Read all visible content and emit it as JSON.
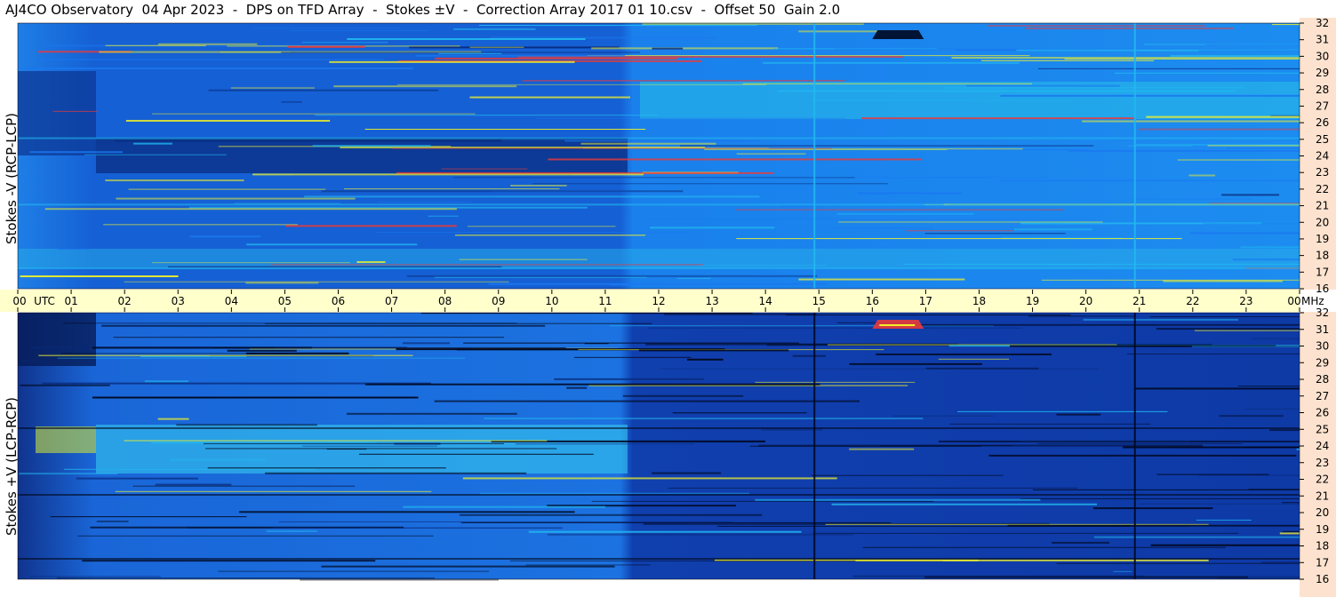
{
  "title": "AJ4CO Observatory  04 Apr 2023  -  DPS on TFD Array  -  Stokes ±V  -  Correction Array 2017 01 10.csv  -  Offset 50  Gain 2.0",
  "colors": {
    "time_axis_bg": "#ffffcc",
    "freq_axis_bg": "#fde3cf",
    "colormap": [
      "#000820",
      "#082a7a",
      "#1046c8",
      "#1a78f0",
      "#22b8f0",
      "#f0f02a",
      "#e83a3a",
      "#ff70ff"
    ]
  },
  "chart_data": [
    {
      "type": "heatmap",
      "panel": "top",
      "ylabel": "Stokes -V (RCP-LCP)",
      "x_ticks": [
        "00",
        "UTC",
        "01",
        "02",
        "03",
        "04",
        "05",
        "06",
        "07",
        "08",
        "09",
        "10",
        "11",
        "12",
        "13",
        "14",
        "15",
        "16",
        "17",
        "18",
        "19",
        "20",
        "21",
        "22",
        "23",
        "00",
        "MHz"
      ],
      "x_range_hours": [
        0,
        24
      ],
      "y_range_mhz": [
        16,
        32
      ],
      "y_ticks": [
        "32",
        "31",
        "30",
        "29",
        "28",
        "27",
        "26",
        "25",
        "24",
        "23",
        "22",
        "21",
        "20",
        "19",
        "18",
        "17",
        "16"
      ]
    },
    {
      "type": "heatmap",
      "panel": "bottom",
      "ylabel": "Stokes +V (LCP-RCP)",
      "x_ticks": [
        "00",
        "UTC",
        "01",
        "02",
        "03",
        "04",
        "05",
        "06",
        "07",
        "08",
        "09",
        "10",
        "11",
        "12",
        "13",
        "14",
        "15",
        "16",
        "17",
        "18",
        "19",
        "20",
        "21",
        "22",
        "23",
        "00",
        "MHz"
      ],
      "x_range_hours": [
        0,
        24
      ],
      "y_range_mhz": [
        16,
        32
      ],
      "y_ticks": [
        "32",
        "31",
        "30",
        "29",
        "28",
        "27",
        "26",
        "25",
        "24",
        "23",
        "22",
        "21",
        "20",
        "19",
        "18",
        "17",
        "16"
      ]
    }
  ]
}
